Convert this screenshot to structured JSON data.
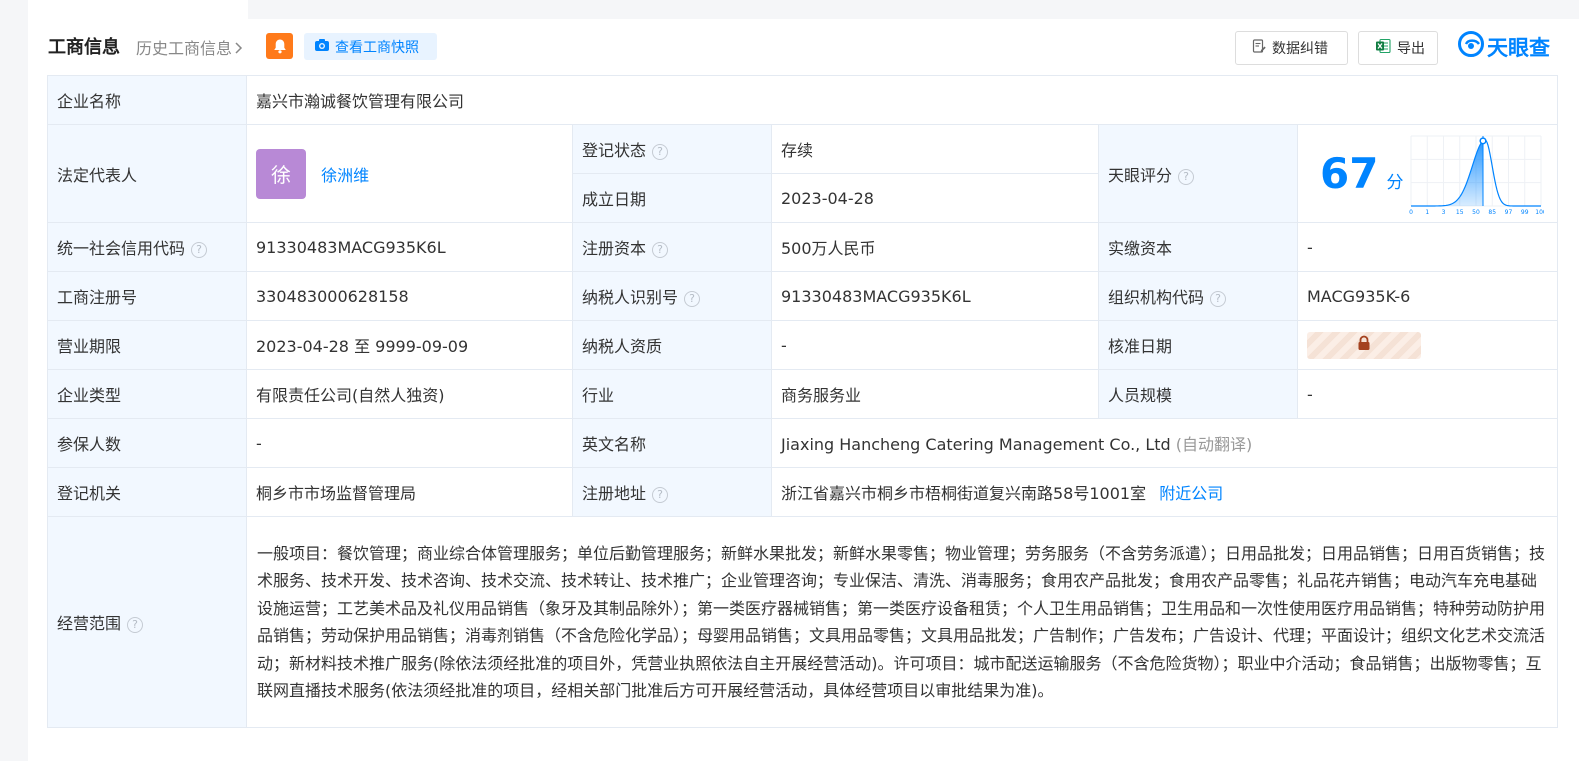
{
  "header": {
    "title": "工商信息",
    "history_link": "历史工商信息",
    "snapshot_button": "查看工商快照",
    "fix_button": "数据纠错",
    "export_button": "导出",
    "logo_text": "天眼查"
  },
  "labels": {
    "company_name": "企业名称",
    "legal_rep": "法定代表人",
    "reg_status": "登记状态",
    "founded": "成立日期",
    "tianyan_score": "天眼评分",
    "credit_code": "统一社会信用代码",
    "reg_capital": "注册资本",
    "paid_capital": "实缴资本",
    "reg_number": "工商注册号",
    "taxpayer_id": "纳税人识别号",
    "org_code": "组织机构代码",
    "business_term": "营业期限",
    "taxpayer_qual": "纳税人资质",
    "approval_date": "核准日期",
    "company_type": "企业类型",
    "industry": "行业",
    "staff_size": "人员规模",
    "insured": "参保人数",
    "english_name": "英文名称",
    "reg_authority": "登记机关",
    "reg_address": "注册地址",
    "business_scope": "经营范围"
  },
  "values": {
    "company_name": "嘉兴市瀚诚餐饮管理有限公司",
    "legal_rep_avatar": "徐",
    "legal_rep": "徐洲维",
    "reg_status": "存续",
    "founded": "2023-04-28",
    "score": "67",
    "score_unit": "分",
    "credit_code": "91330483MACG935K6L",
    "reg_capital": "500万人民币",
    "paid_capital": "-",
    "reg_number": "330483000628158",
    "taxpayer_id": "91330483MACG935K6L",
    "org_code": "MACG935K-6",
    "business_term": "2023-04-28 至 9999-09-09",
    "taxpayer_qual": "-",
    "company_type": "有限责任公司(自然人独资)",
    "industry": "商务服务业",
    "staff_size": "-",
    "insured": "-",
    "english_name": "Jiaxing Hancheng Catering Management Co., Ltd",
    "english_auto": "(自动翻译)",
    "reg_authority": "桐乡市市场监督管理局",
    "reg_address": "浙江省嘉兴市桐乡市梧桐街道复兴南路58号1001室",
    "nearby_link": "附近公司",
    "business_scope": "一般项目：餐饮管理；商业综合体管理服务；单位后勤管理服务；新鲜水果批发；新鲜水果零售；物业管理；劳务服务（不含劳务派遣）；日用品批发；日用品销售；日用百货销售；技术服务、技术开发、技术咨询、技术交流、技术转让、技术推广；企业管理咨询；专业保洁、清洗、消毒服务；食用农产品批发；食用农产品零售；礼品花卉销售；电动汽车充电基础设施运营；工艺美术品及礼仪用品销售（象牙及其制品除外）；第一类医疗器械销售；第一类医疗设备租赁；个人卫生用品销售；卫生用品和一次性使用医疗用品销售；特种劳动防护用品销售；劳动保护用品销售；消毒剂销售（不含危险化学品）；母婴用品销售；文具用品零售；文具用品批发；广告制作；广告发布；广告设计、代理；平面设计；组织文化艺术交流活动；新材料技术推广服务(除依法须经批准的项目外，凭营业执照依法自主开展经营活动)。许可项目：城市配送运输服务（不含危险货物）；职业中介活动；食品销售；出版物零售；互联网直播技术服务(依法须经批准的项目，经相关部门批准后方可开展经营活动，具体经营项目以审批结果为准)。"
  },
  "score_chart": {
    "ticks": [
      "0",
      "1",
      "3",
      "15",
      "50",
      "85",
      "97",
      "99",
      "100"
    ],
    "score": 67,
    "accent": "#0084ff"
  },
  "colors": {
    "accent": "#0084ff",
    "label_bg": "#f2f8ff",
    "status_green": "#1aa05a",
    "bell_orange": "#ff7a1a",
    "avatar_purple": "#b889d6"
  }
}
